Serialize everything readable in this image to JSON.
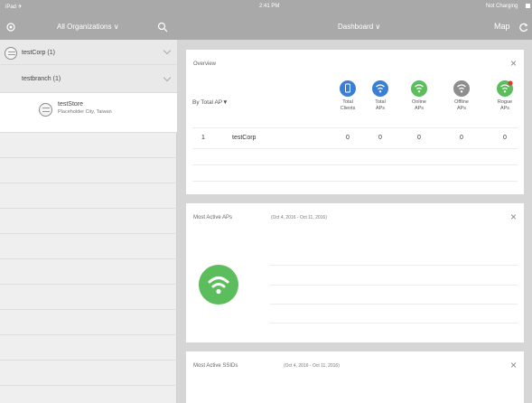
{
  "status_bar": {
    "left": "iPad ✈",
    "time": "2:41 PM",
    "right": "Not Charging"
  },
  "sidebar_header": {
    "org_selector": "All Organizations ∨"
  },
  "main_header": {
    "title": "Dashboard ∨",
    "map_label": "Map"
  },
  "sidebar": {
    "org": "testCorp (1)",
    "branch": "testbranch (1)",
    "store_name": "testStore",
    "store_location": "Placeholder City, Taiwan"
  },
  "overview": {
    "title": "Overview",
    "sort_label": "By Total AP▼",
    "columns": [
      {
        "label1": "Total",
        "label2": "Clients",
        "color": "#3a7fd4",
        "icon": "clients-icon"
      },
      {
        "label1": "Total",
        "label2": "APs",
        "color": "#3a7fd4",
        "icon": "wifi-icon"
      },
      {
        "label1": "Online",
        "label2": "APs",
        "color": "#5bbd5b",
        "icon": "wifi-icon"
      },
      {
        "label1": "Offline",
        "label2": "APs",
        "color": "#8e8e8e",
        "icon": "wifi-icon"
      },
      {
        "label1": "Rogue",
        "label2": "APs",
        "color": "#5bbd5b",
        "icon": "rogue-wifi-icon"
      }
    ],
    "row": {
      "rank": "1",
      "name": "testCorp",
      "values": [
        "0",
        "0",
        "0",
        "0",
        "0"
      ]
    }
  },
  "most_active_aps": {
    "title": "Most Active APs",
    "range": "(Oct 4, 2016 - Oct 11, 2016)"
  },
  "most_active_ssids": {
    "title": "Most Active SSIDs",
    "range": "(Oct 4, 2016 - Oct 11, 2016)"
  },
  "colors": {
    "nav": "#a9a9a9",
    "sidebar": "#efefef",
    "main": "#d6d6d6",
    "accent_blue": "#3a7fd4",
    "accent_green": "#5bbd5b",
    "gray": "#8e8e8e"
  }
}
